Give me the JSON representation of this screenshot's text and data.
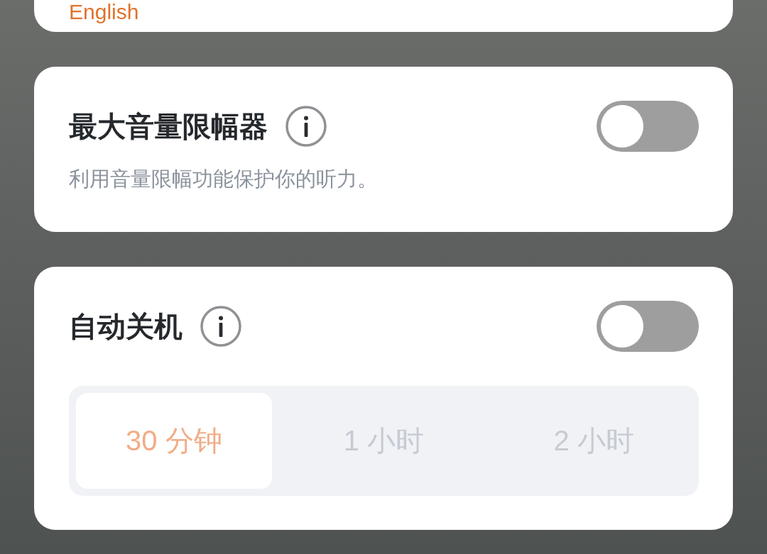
{
  "top_card": {
    "value": "English"
  },
  "settings": [
    {
      "kind": "toggle",
      "title": "最大音量限幅器",
      "description": "利用音量限幅功能保护你的听力。",
      "on": false
    },
    {
      "kind": "toggle-options",
      "title": "自动关机",
      "on": false,
      "options": [
        {
          "label": "30 分钟",
          "selected": true
        },
        {
          "label": "1 小时",
          "selected": false
        },
        {
          "label": "2 小时",
          "selected": false
        }
      ]
    }
  ]
}
